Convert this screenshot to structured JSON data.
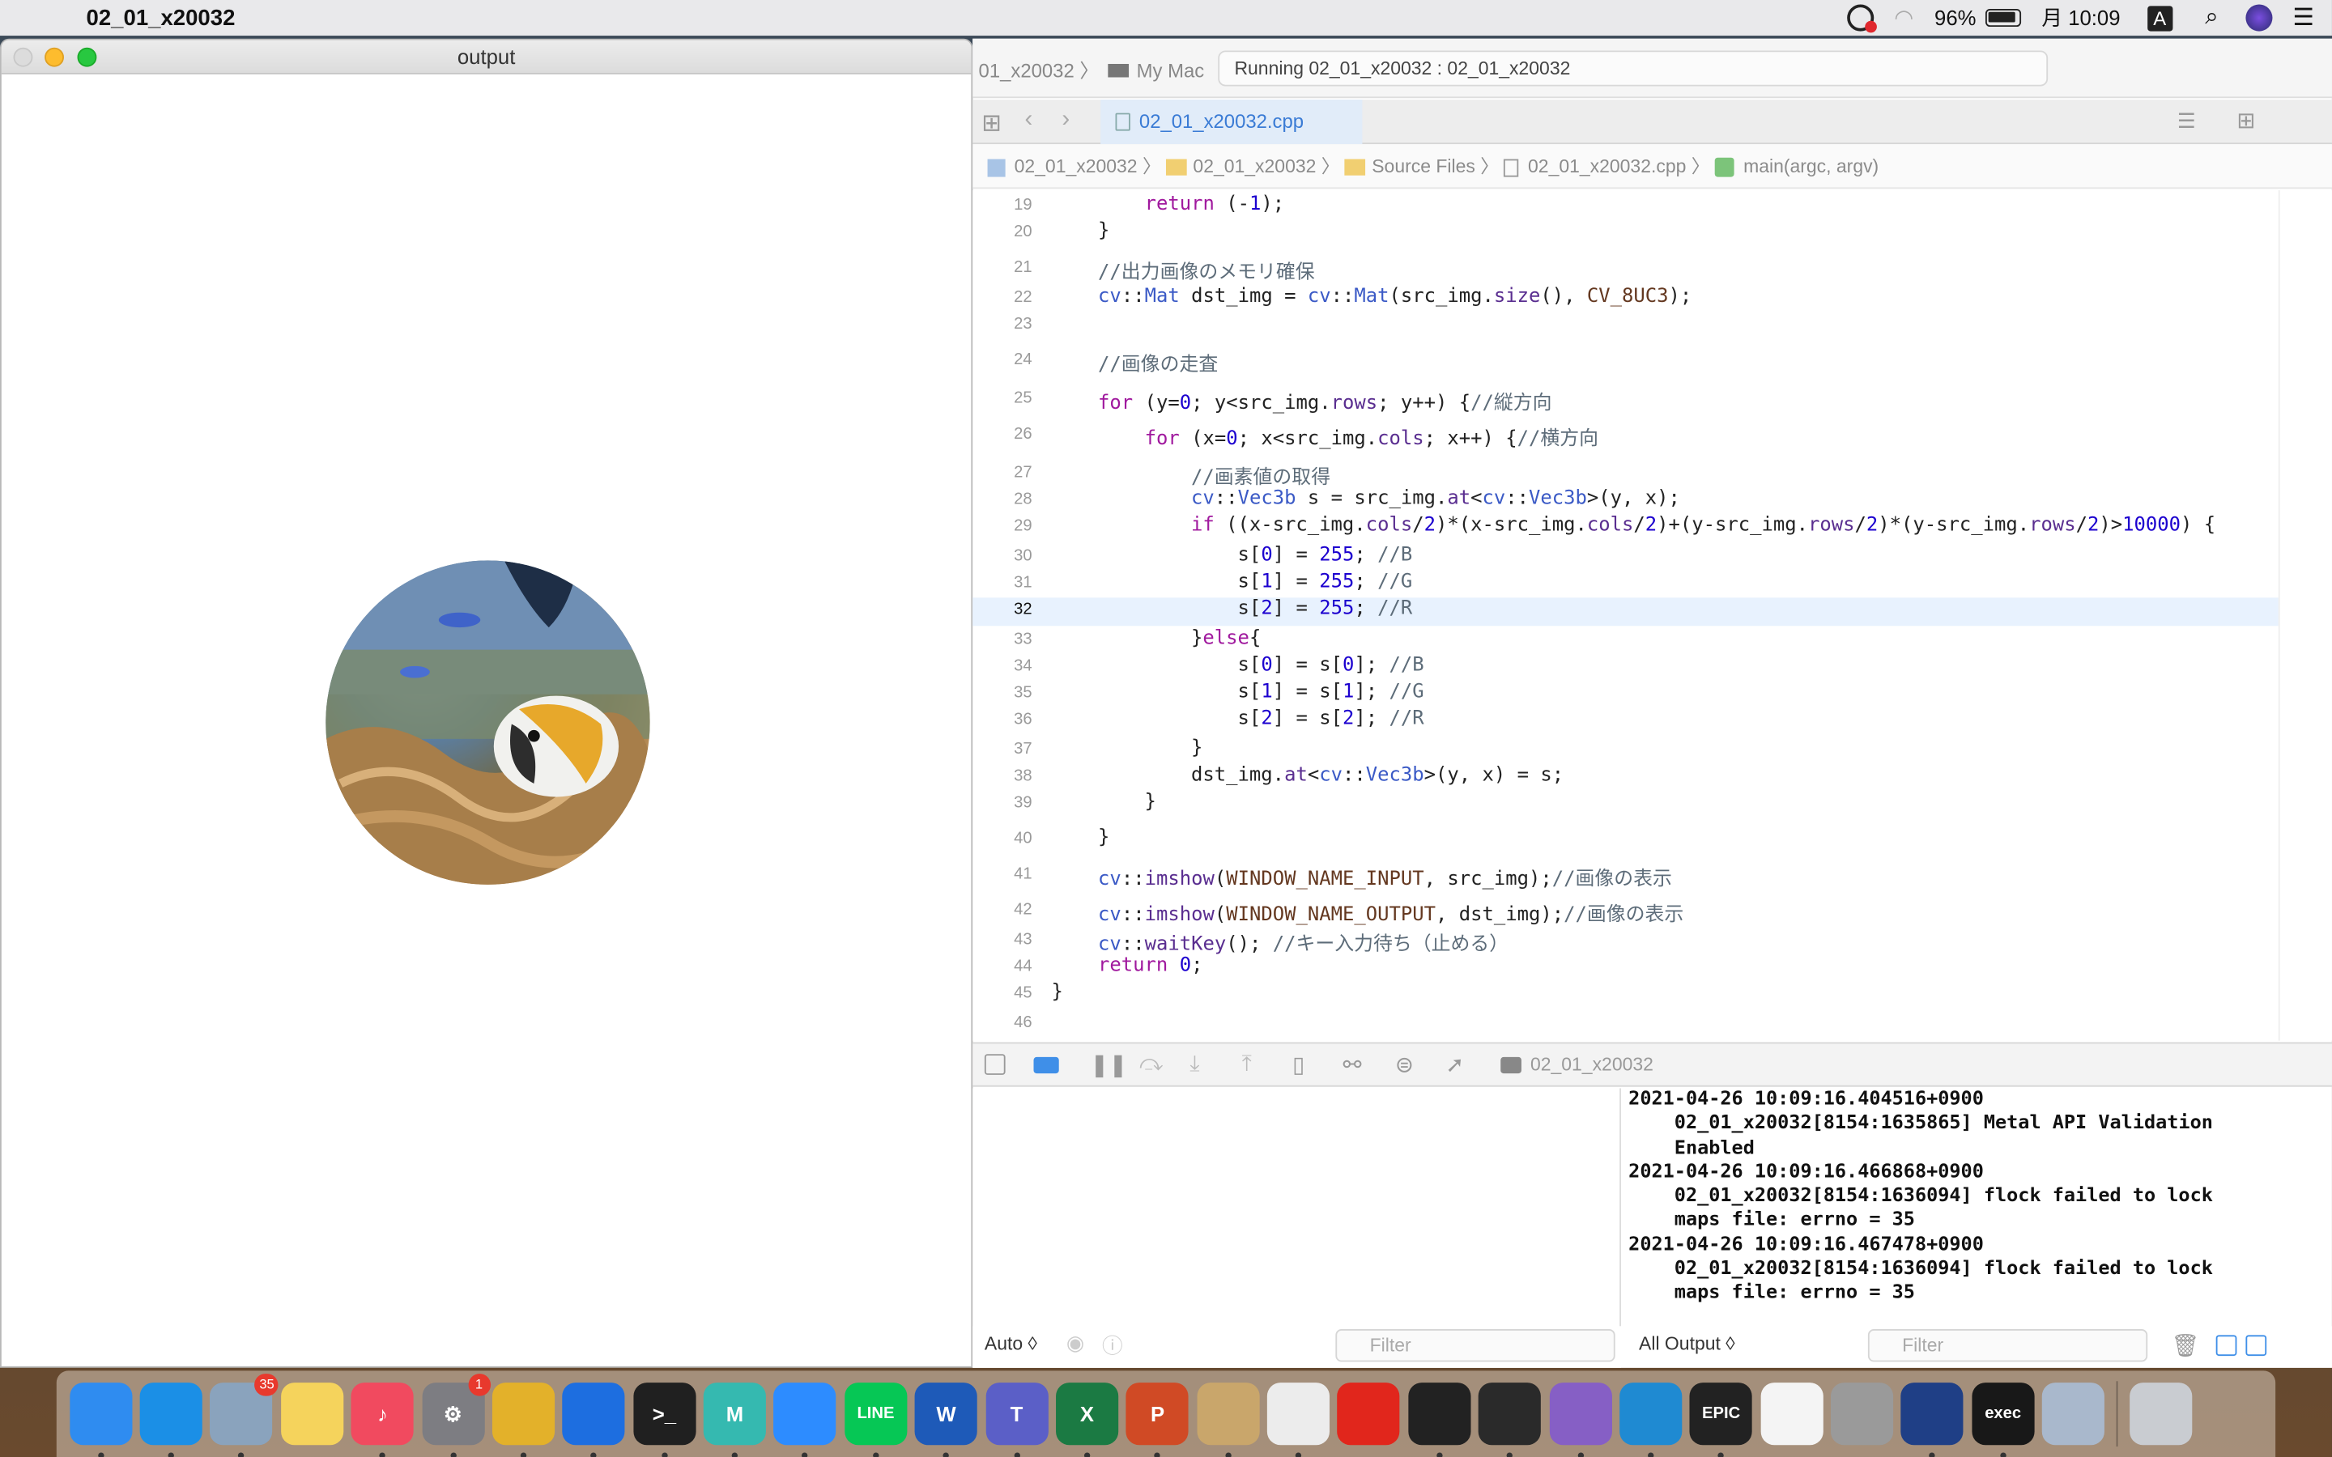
{
  "menubar": {
    "app_name": "02_01_x20032",
    "battery": "96%",
    "clock": "月 10:09",
    "input_mode": "A"
  },
  "output_window": {
    "title": "output"
  },
  "xcode": {
    "scheme": "01_x20032",
    "destination": "My Mac",
    "run_status": "Running 02_01_x20032 : 02_01_x20032",
    "active_tab": "02_01_x20032.cpp",
    "jumpbar": [
      "02_01_x20032",
      "02_01_x20032",
      "Source Files",
      "02_01_x20032.cpp",
      "main(argc, argv)"
    ],
    "debug_target": "02_01_x20032",
    "var_scope": "Auto ◊",
    "output_scope": "All Output ◊",
    "filter_placeholder": "Filter",
    "current_line": 32,
    "code_lines": [
      {
        "n": "19",
        "html": "        <span class='kw'>return</span> (-<span class='nm'>1</span>);"
      },
      {
        "n": "20",
        "html": "    }"
      },
      {
        "n": "21",
        "html": "    <span class='cm'>//出力画像のメモリ確保</span>"
      },
      {
        "n": "22",
        "html": "    <span class='ty'>cv</span>::<span class='ty'>Mat</span> dst_img = <span class='ty'>cv</span>::<span class='ty'>Mat</span>(src_img.<span class='fn'>size</span>(), <span class='mc'>CV_8UC3</span>);"
      },
      {
        "n": "23",
        "html": ""
      },
      {
        "n": "24",
        "html": "    <span class='cm'>//画像の走査</span>"
      },
      {
        "n": "25",
        "html": "    <span class='kw'>for</span> (y=<span class='nm'>0</span>; y&lt;src_img.<span class='fn'>rows</span>; y++) {<span class='cm'>//縦方向</span>"
      },
      {
        "n": "26",
        "html": "        <span class='kw'>for</span> (x=<span class='nm'>0</span>; x&lt;src_img.<span class='fn'>cols</span>; x++) {<span class='cm'>//横方向</span>"
      },
      {
        "n": "27",
        "html": "            <span class='cm'>//画素値の取得</span>"
      },
      {
        "n": "28",
        "html": "            <span class='ty'>cv</span>::<span class='ty'>Vec3b</span> s = src_img.<span class='fn'>at</span>&lt;<span class='ty'>cv</span>::<span class='ty'>Vec3b</span>&gt;(y, x);"
      },
      {
        "n": "29",
        "html": "            <span class='kw'>if</span> ((x-src_img.<span class='fn'>cols</span>/<span class='nm'>2</span>)*(x-src_img.<span class='fn'>cols</span>/<span class='nm'>2</span>)+(y-src_img.<span class='fn'>rows</span>/<span class='nm'>2</span>)*(y-src_img.<span class='fn'>rows</span>/<span class='nm'>2</span>)&gt;<span class='nm'>10000</span>) {"
      },
      {
        "n": "30",
        "html": "                s[<span class='nm'>0</span>] = <span class='nm'>255</span>; <span class='cm'>//B</span>"
      },
      {
        "n": "31",
        "html": "                s[<span class='nm'>1</span>] = <span class='nm'>255</span>; <span class='cm'>//G</span>"
      },
      {
        "n": "32",
        "html": "                s[<span class='nm'>2</span>] = <span class='nm'>255</span>; <span class='cm'>//R</span>"
      },
      {
        "n": "33",
        "html": "            }<span class='kw'>else</span>{"
      },
      {
        "n": "34",
        "html": "                s[<span class='nm'>0</span>] = s[<span class='nm'>0</span>]; <span class='cm'>//B</span>"
      },
      {
        "n": "35",
        "html": "                s[<span class='nm'>1</span>] = s[<span class='nm'>1</span>]; <span class='cm'>//G</span>"
      },
      {
        "n": "36",
        "html": "                s[<span class='nm'>2</span>] = s[<span class='nm'>2</span>]; <span class='cm'>//R</span>"
      },
      {
        "n": "37",
        "html": "            }"
      },
      {
        "n": "38",
        "html": "            dst_img.<span class='fn'>at</span>&lt;<span class='ty'>cv</span>::<span class='ty'>Vec3b</span>&gt;(y, x) = s;"
      },
      {
        "n": "39",
        "html": "        }"
      },
      {
        "n": "40",
        "html": "    }"
      },
      {
        "n": "41",
        "html": "    <span class='ty'>cv</span>::<span class='fn'>imshow</span>(<span class='mc'>WINDOW_NAME_INPUT</span>, src_img);<span class='cm'>//画像の表示</span>"
      },
      {
        "n": "42",
        "html": "    <span class='ty'>cv</span>::<span class='fn'>imshow</span>(<span class='mc'>WINDOW_NAME_OUTPUT</span>, dst_img);<span class='cm'>//画像の表示</span>"
      },
      {
        "n": "43",
        "html": "    <span class='ty'>cv</span>::<span class='fn'>waitKey</span>(); <span class='cm'>//キー入力待ち（止める）</span>"
      },
      {
        "n": "44",
        "html": "    <span class='kw'>return</span> <span class='nm'>0</span>;"
      },
      {
        "n": "45",
        "html": "}"
      },
      {
        "n": "46",
        "html": ""
      }
    ],
    "console": "2021-04-26 10:09:16.404516+0900\n    02_01_x20032[8154:1635865] Metal API Validation\n    Enabled\n2021-04-26 10:09:16.466868+0900\n    02_01_x20032[8154:1636094] flock failed to lock\n    maps file: errno = 35\n2021-04-26 10:09:16.467478+0900\n    02_01_x20032[8154:1636094] flock failed to lock\n    maps file: errno = 35"
  },
  "dock": [
    {
      "name": "finder-icon",
      "color": "#2f8cf0",
      "label": ""
    },
    {
      "name": "safari-icon",
      "color": "#1b8fe6",
      "label": ""
    },
    {
      "name": "mail-icon",
      "color": "#8aa3bd",
      "label": "",
      "badge": "35"
    },
    {
      "name": "notes-icon",
      "color": "#f5d35c",
      "label": ""
    },
    {
      "name": "music-icon",
      "color": "#f14a5f",
      "label": "♪"
    },
    {
      "name": "system-preferences-icon",
      "color": "#7d7d82",
      "label": "⚙",
      "badge": "1"
    },
    {
      "name": "chrome-icon",
      "color": "#e3b12a",
      "label": ""
    },
    {
      "name": "xcode-icon",
      "color": "#1d6ee0",
      "label": ""
    },
    {
      "name": "terminal-icon",
      "color": "#202020",
      "label": ">_"
    },
    {
      "name": "maya-icon",
      "color": "#35b9b0",
      "label": "M"
    },
    {
      "name": "zoom-icon",
      "color": "#2d8cff",
      "label": ""
    },
    {
      "name": "line-icon",
      "color": "#06c755",
      "label": "LINE"
    },
    {
      "name": "word-icon",
      "color": "#1e5ab8",
      "label": "W"
    },
    {
      "name": "teams-icon",
      "color": "#5b5fc7",
      "label": "T"
    },
    {
      "name": "excel-icon",
      "color": "#1b7a43",
      "label": "X"
    },
    {
      "name": "powerpoint-icon",
      "color": "#d04a25",
      "label": "P"
    },
    {
      "name": "script-editor-icon",
      "color": "#c9a66b",
      "label": ""
    },
    {
      "name": "unity-icon",
      "color": "#ececec",
      "label": ""
    },
    {
      "name": "acrobat-icon",
      "color": "#e1261c",
      "label": ""
    },
    {
      "name": "unity-hub-icon",
      "color": "#222222",
      "label": ""
    },
    {
      "name": "unity-icon-2",
      "color": "#2a2a2a",
      "label": ""
    },
    {
      "name": "visual-studio-icon",
      "color": "#865fc5",
      "label": ""
    },
    {
      "name": "vscode-icon",
      "color": "#1f8ad2",
      "label": ""
    },
    {
      "name": "epic-games-icon",
      "color": "#222222",
      "label": "EPIC"
    },
    {
      "name": "textedit-icon",
      "color": "#f4f4f4",
      "label": ""
    },
    {
      "name": "automator-icon",
      "color": "#9a9a9a",
      "label": ""
    },
    {
      "name": "instruments-icon",
      "color": "#1f3f86",
      "label": ""
    },
    {
      "name": "exec-icon",
      "color": "#181818",
      "label": "exec"
    },
    {
      "name": "screenshot-folder-icon",
      "color": "#a9b8cc",
      "label": ""
    },
    {
      "name": "trash-icon",
      "color": "#c9ccd1",
      "label": ""
    }
  ]
}
